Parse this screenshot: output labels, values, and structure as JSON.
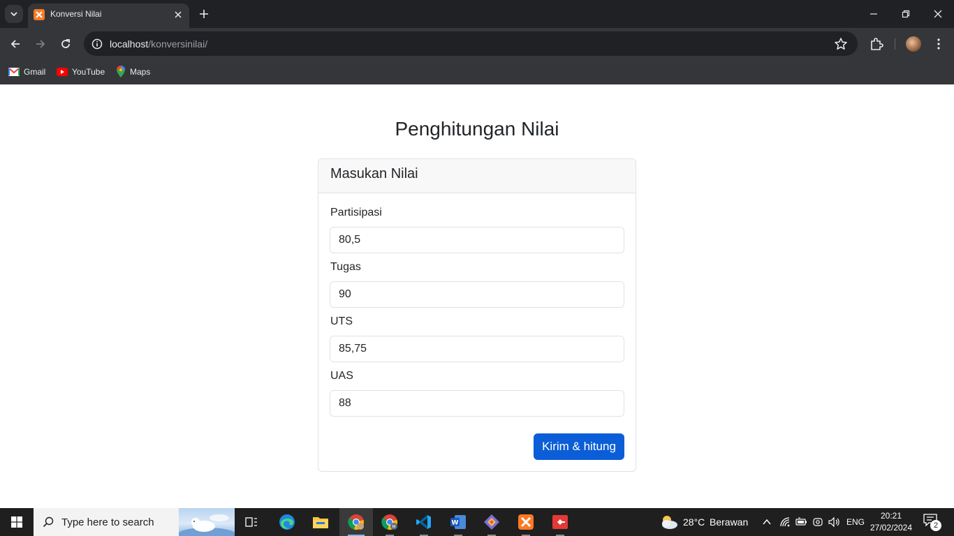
{
  "browser": {
    "tab": {
      "title": "Konversi Nilai",
      "favicon": "xampp-icon"
    },
    "address": {
      "host": "localhost",
      "path": "/konversinilai/"
    },
    "bookmarks": [
      {
        "label": "Gmail",
        "icon": "gmail-icon"
      },
      {
        "label": "YouTube",
        "icon": "youtube-icon"
      },
      {
        "label": "Maps",
        "icon": "maps-icon"
      }
    ]
  },
  "page": {
    "title": "Penghitungan Nilai",
    "card_title": "Masukan Nilai",
    "fields": [
      {
        "label": "Partisipasi",
        "value": "80,5"
      },
      {
        "label": "Tugas",
        "value": "90"
      },
      {
        "label": "UTS",
        "value": "85,75"
      },
      {
        "label": "UAS",
        "value": "88"
      }
    ],
    "submit_label": "Kirim & hitung",
    "accent_color": "#0b5ed7"
  },
  "taskbar": {
    "search_placeholder": "Type here to search",
    "weather": {
      "temp": "28°C",
      "condition": "Berawan"
    },
    "language": "ENG",
    "time": "20:21",
    "date": "27/02/2024",
    "notification_count": "2"
  }
}
